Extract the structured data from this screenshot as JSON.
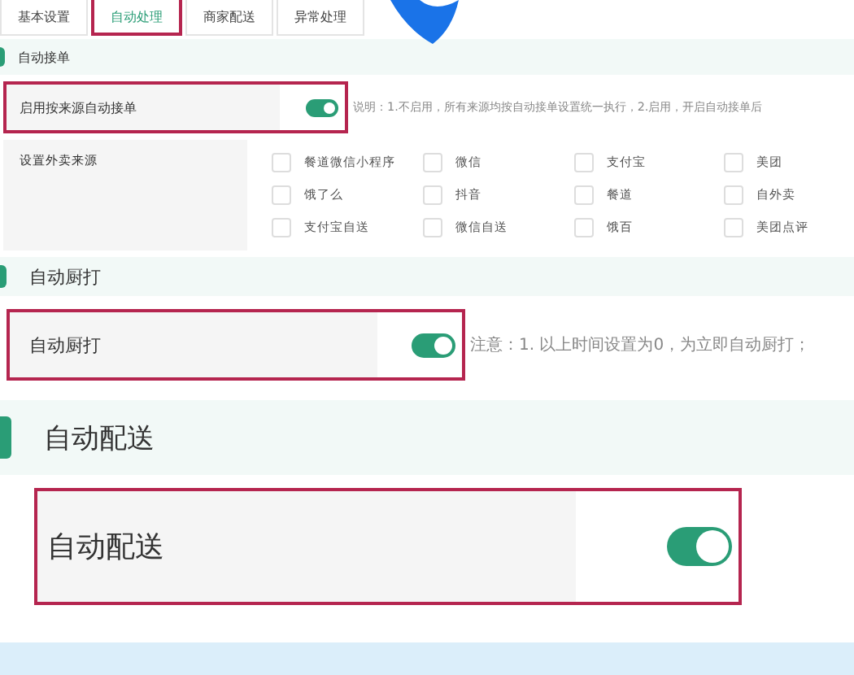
{
  "tabs": [
    {
      "label": "基本设置",
      "selected": false,
      "highlighted": false
    },
    {
      "label": "自动处理",
      "selected": true,
      "highlighted": true
    },
    {
      "label": "商家配送",
      "selected": false,
      "highlighted": false
    },
    {
      "label": "异常处理",
      "selected": false,
      "highlighted": false
    }
  ],
  "sections": [
    {
      "title": "自动接单",
      "rows": [
        {
          "kind": "toggle",
          "label": "启用按来源自动接单",
          "on": true,
          "highlighted": true,
          "note": "说明：1.不启用，所有来源均按自动接单设置统一执行，2.启用，开启自动接单后"
        },
        {
          "kind": "checkboxes",
          "label": "设置外卖来源",
          "options": [
            {
              "label": "餐道微信小程序",
              "checked": false
            },
            {
              "label": "微信",
              "checked": false
            },
            {
              "label": "支付宝",
              "checked": false
            },
            {
              "label": "美团",
              "checked": false
            },
            {
              "label": "饿了么",
              "checked": false
            },
            {
              "label": "抖音",
              "checked": false
            },
            {
              "label": "餐道",
              "checked": false
            },
            {
              "label": "自外卖",
              "checked": false
            },
            {
              "label": "支付宝自送",
              "checked": false
            },
            {
              "label": "微信自送",
              "checked": false
            },
            {
              "label": "饿百",
              "checked": false
            },
            {
              "label": "美团点评",
              "checked": false
            }
          ]
        }
      ]
    },
    {
      "title": "自动厨打",
      "rows": [
        {
          "kind": "toggle",
          "label": "自动厨打",
          "on": true,
          "highlighted": true,
          "note": "注意：1. 以上时间设置为0，为立即自动厨打；"
        }
      ]
    },
    {
      "title": "自动配送",
      "rows": [
        {
          "kind": "toggle",
          "label": "自动配送",
          "on": true,
          "highlighted": true
        }
      ]
    }
  ]
}
